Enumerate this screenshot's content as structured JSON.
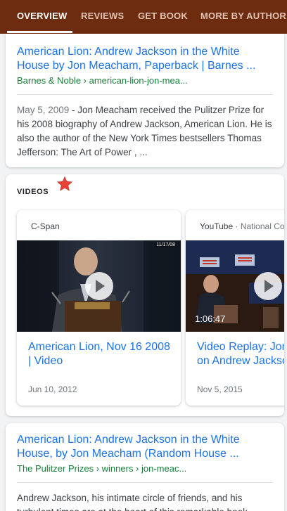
{
  "tabs": [
    {
      "label": "OVERVIEW",
      "active": true
    },
    {
      "label": "REVIEWS",
      "active": false
    },
    {
      "label": "GET BOOK",
      "active": false
    },
    {
      "label": "MORE BY AUTHOR",
      "active": false
    }
  ],
  "result1": {
    "title": "American Lion: Andrew Jackson in the White House by Jon Meacham, Paperback | Barnes ...",
    "url": "Barnes & Noble › american-lion-jon-mea...",
    "date": "May 5, 2009",
    "snippet": " - Jon Meacham received the Pulitzer Prize for his 2008 biography of Andrew Jackson, American Lion. He is also the author of the New York Times bestsellers Thomas Jefferson: The Art of Power , ..."
  },
  "videos": {
    "header": "VIDEOS",
    "items": [
      {
        "source": "C-Span",
        "source_extra": "",
        "duration": "",
        "corner_text": "11/17/08",
        "title": "American Lion, Nov 16 2008 | Video",
        "date": "Jun 10, 2012"
      },
      {
        "source": "YouTube",
        "source_extra": "National Constitution Center",
        "duration": "1:06:47",
        "corner_text": "",
        "title": "Video Replay: Jon Meacham on Andrew Jackson",
        "date": "Nov 5, 2015"
      }
    ]
  },
  "result2": {
    "title": "American Lion: Andrew Jackson in the White House, by Jon Meacham (Random House ...",
    "url": "The Pulitzer Prizes › winners › jon-meac...",
    "snippet": "Andrew Jackson, his intimate circle of friends, and his turbulent times are at the heart of this remarkable book"
  },
  "colors": {
    "tabbar": "#6d2b0f",
    "link": "#1a73e8",
    "url_green": "#188038",
    "star": "#ea4335"
  }
}
